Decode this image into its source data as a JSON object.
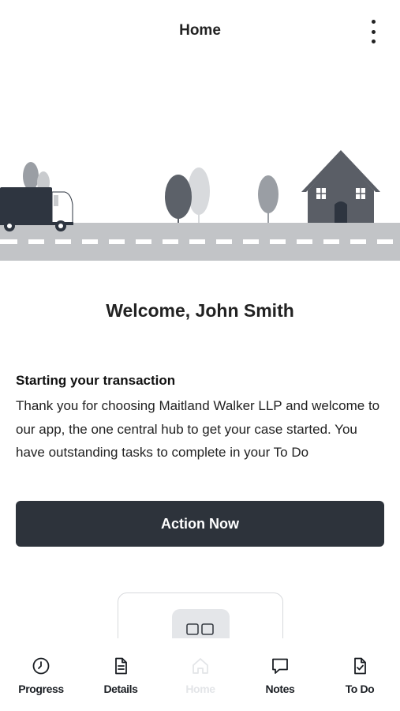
{
  "header": {
    "title": "Home",
    "more_icon": "more-vertical-icon"
  },
  "hero": {
    "illustration": "moving-truck-road-house"
  },
  "welcome": {
    "text": "Welcome, John Smith"
  },
  "transaction": {
    "title": "Starting your transaction",
    "body": "Thank you for choosing Maitland Walker LLP and welcome to our app, the one central hub to get your case started. You have outstanding tasks to complete in your To Do"
  },
  "action": {
    "label": "Action Now"
  },
  "card": {
    "icon": "card-glyph-icon"
  },
  "nav": {
    "items": [
      {
        "label": "Progress",
        "icon": "clock-icon"
      },
      {
        "label": "Details",
        "icon": "document-icon"
      },
      {
        "label": "Home",
        "icon": "home-icon"
      },
      {
        "label": "Notes",
        "icon": "chat-bubble-icon"
      },
      {
        "label": "To Do",
        "icon": "checklist-icon"
      }
    ]
  },
  "colors": {
    "primary": "#2d333b",
    "road": "#c2c4c7",
    "truck": "#2e3540",
    "house": "#5a5e66",
    "tree_dark": "#5c6169",
    "tree_light": "#c9cbce",
    "disabled_text": "#e3e5e8"
  }
}
